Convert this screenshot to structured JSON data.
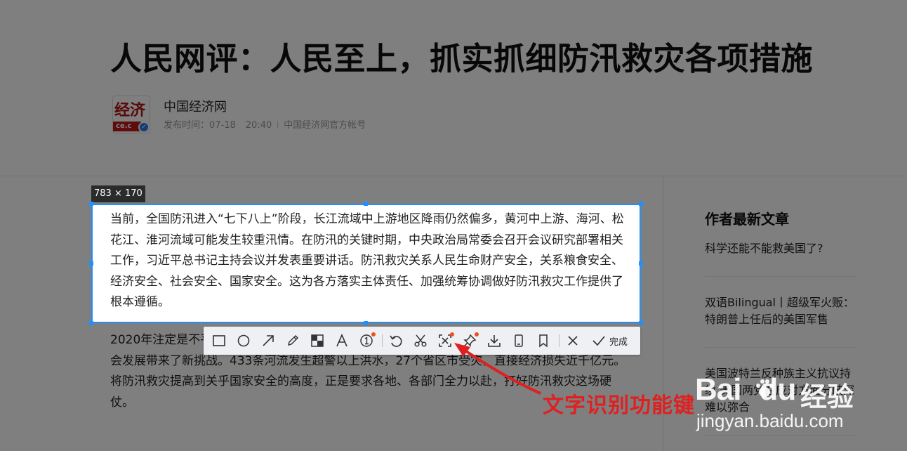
{
  "article": {
    "title": "人民网评：人民至上，抓实抓细防汛救灾各项措施",
    "author": {
      "name": "中国经济网",
      "logo_text_top": "经济",
      "logo_text_bottom": "ce.c",
      "publish_label": "发布时间：07-18",
      "publish_time": "20:40",
      "account": "中国经济网官方帐号"
    },
    "paragraphs": [
      "当前，全国防汛进入“七下八上”阶段，长江流域中上游地区降雨仍然偏多，黄河中上游、海河、松花江、淮河流域可能发生较重汛情。在防汛的关键时期，中央政治局常委会召开会议研究部署相关工作，习近平总书记主持会议并发表重要讲话。防汛救灾关系人民生命财产安全，关系粮食安全、经济安全、社会安全、国家安全。这为各方落实主体责任、加强统筹协调做好防汛救灾工作提供了根本遵循。",
      "2020年注定是不平凡的一年，正是疫情防控阻击战取得重大战略成果的时刻，洪涝灾害又为经济社会发展带来了新挑战。433条河流发生超警以上洪水，27个省区市受灾，直接经济损失近千亿元。将防汛救灾提高到关乎国家安全的高度，正是要求各地、各部门全力以赴，打好防汛救灾这场硬仗。"
    ]
  },
  "sidebar": {
    "title": "作者最新文章",
    "items": [
      "科学还能不能救美国了?",
      "双语Bilingual丨超级军火贩：特朗普上任后的美国军售",
      "美国波特兰反种族主义抗议持续 美国两党在应对方面分歧深难以弥合"
    ]
  },
  "screenshot_tool": {
    "size_label": "783 × 170",
    "done_label": "完成",
    "tools": [
      "rectangle-tool",
      "ellipse-tool",
      "arrow-tool",
      "pen-tool",
      "mosaic-tool",
      "text-tool",
      "number-tool",
      "undo",
      "screenshot-edit",
      "ocr-text-recognition",
      "pin",
      "download",
      "long-screenshot",
      "save-bookmark",
      "cancel"
    ]
  },
  "annotation": {
    "text": "文字识别功能键",
    "color": "#e02020"
  },
  "watermark": {
    "brand": "Bai",
    "brand_suffix": "du",
    "service": "经验",
    "url": "jingyan.baidu.com"
  },
  "colors": {
    "selection": "#1e90ff",
    "toolbar_dot": "#f0501e",
    "verified": "#2b7de9"
  }
}
